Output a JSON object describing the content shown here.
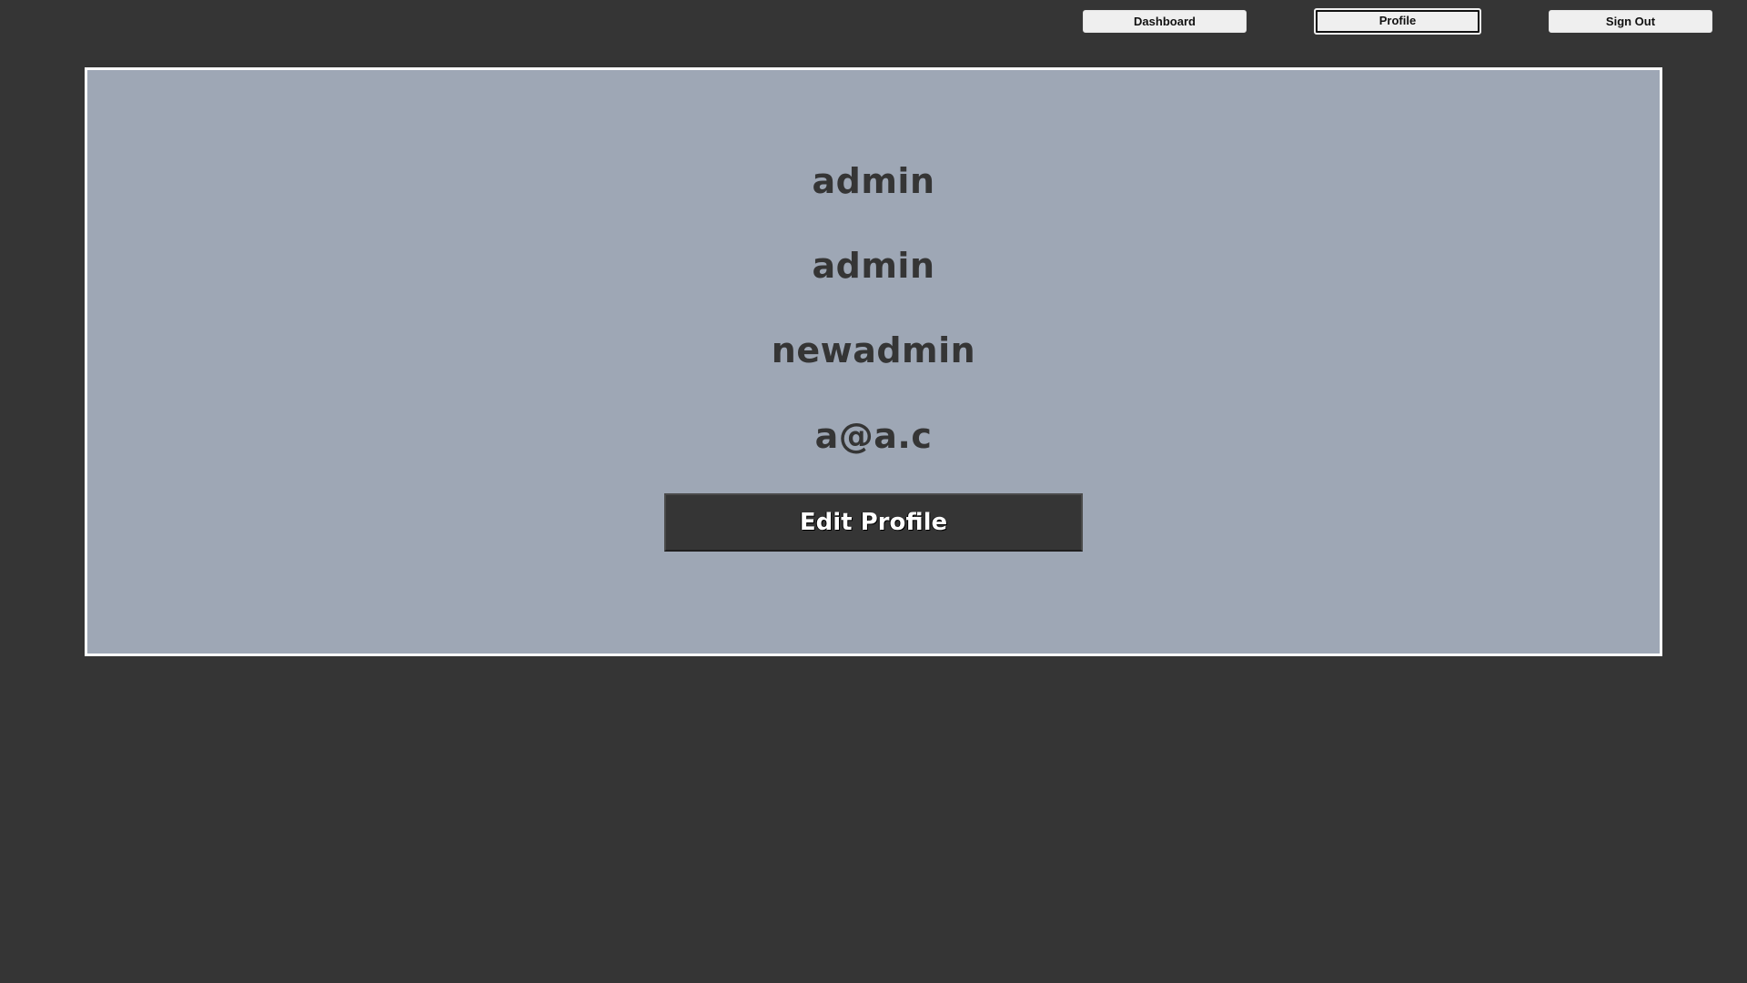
{
  "nav": {
    "dashboard_label": "Dashboard",
    "profile_label": "Profile",
    "signout_label": "Sign Out",
    "active": "Profile"
  },
  "profile": {
    "fields": [
      "admin",
      "admin",
      "newadmin",
      "a@a.c"
    ],
    "edit_button_label": "Edit Profile"
  },
  "colors": {
    "background": "#353535",
    "panel": "#9ea7b5",
    "panel_border": "#ffffff",
    "text": "#353535",
    "button_bg": "#353535",
    "button_text": "#ffffff",
    "nav_button_bg": "#efefef"
  }
}
